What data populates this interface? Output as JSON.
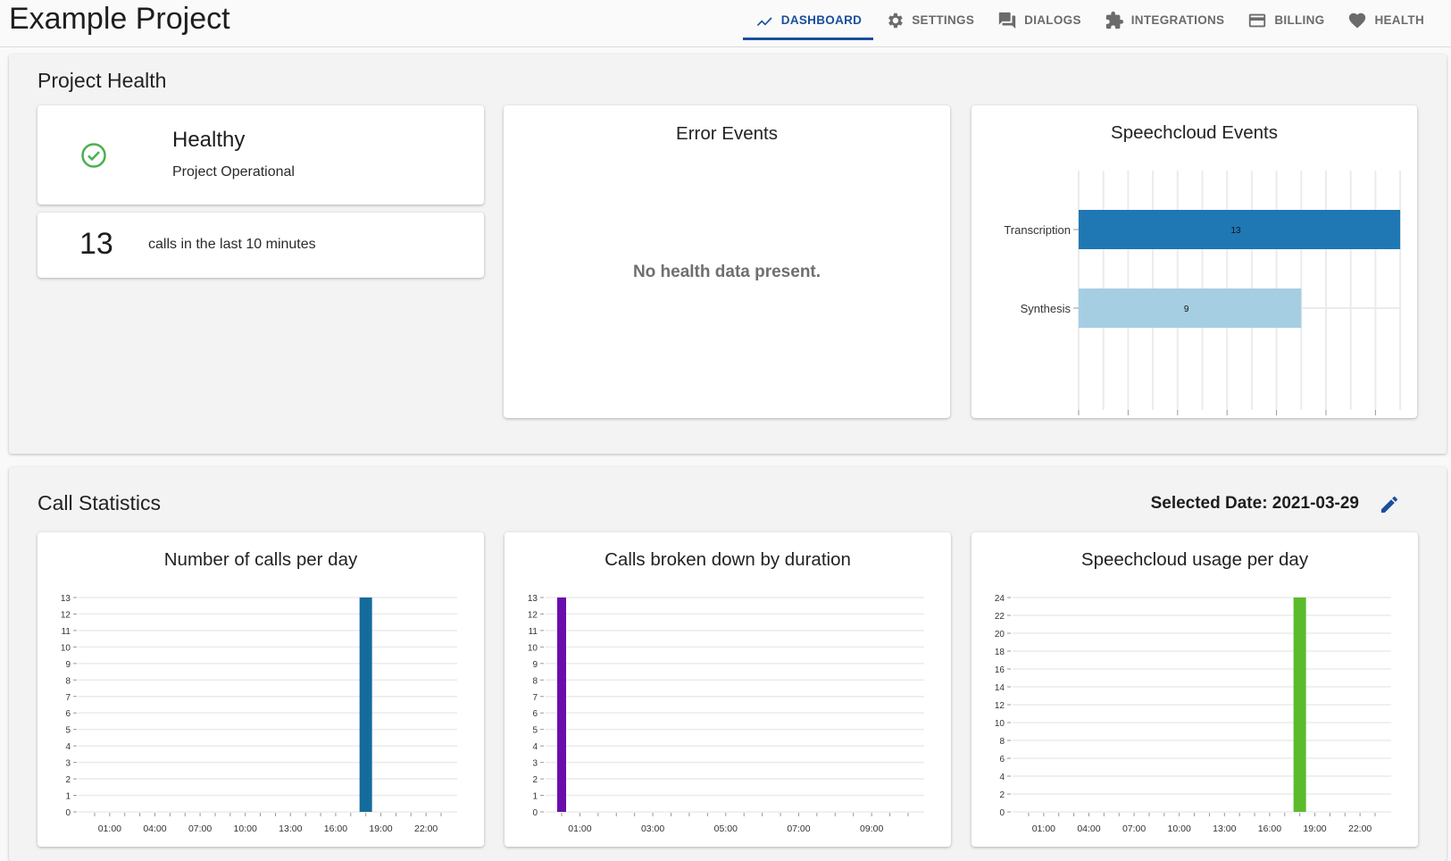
{
  "app": {
    "title": "Example Project"
  },
  "nav": {
    "tabs": [
      {
        "label": "DASHBOARD",
        "icon": "trending-line-icon",
        "active": true
      },
      {
        "label": "SETTINGS",
        "icon": "gear-icon",
        "active": false
      },
      {
        "label": "DIALOGS",
        "icon": "chat-bubbles-icon",
        "active": false
      },
      {
        "label": "INTEGRATIONS",
        "icon": "puzzle-piece-icon",
        "active": false
      },
      {
        "label": "BILLING",
        "icon": "credit-card-icon",
        "active": false
      },
      {
        "label": "HEALTH",
        "icon": "heart-icon",
        "active": false
      }
    ]
  },
  "health": {
    "section_title": "Project Health",
    "status": {
      "title": "Healthy",
      "subtitle": "Project Operational",
      "icon": "check-circle-icon",
      "color": "#4caf50"
    },
    "recent_calls": {
      "count": "13",
      "text": "calls in the last 10 minutes"
    },
    "error_events": {
      "title": "Error Events",
      "empty_text": "No health data present."
    },
    "speechcloud_events": {
      "title": "Speechcloud Events"
    }
  },
  "stats": {
    "section_title": "Call Statistics",
    "selected_date": "Selected Date: 2021-03-29",
    "edit_icon": "pencil-icon"
  },
  "colors": {
    "accent": "#1a4f9c",
    "transcription": "#1f77b4",
    "synthesis": "#a6cee3",
    "calls_per_day": "#156c9c",
    "duration": "#6a0dad",
    "usage": "#5bbb2b"
  },
  "chart_data": [
    {
      "id": "speechcloud-events",
      "type": "bar",
      "orientation": "horizontal",
      "title": "Speechcloud Events",
      "categories": [
        "Transcription",
        "Synthesis"
      ],
      "values": [
        13,
        9
      ],
      "data_labels": [
        "13",
        "9"
      ],
      "xlim": [
        0,
        13
      ],
      "xticks": [
        0,
        2,
        4,
        6,
        8,
        10,
        12
      ],
      "grid": true
    },
    {
      "id": "calls-per-day",
      "type": "bar",
      "title": "Number of calls per day",
      "x_hours": [
        18
      ],
      "values": [
        13
      ],
      "ylim": [
        0,
        13
      ],
      "yticks": [
        0,
        1,
        2,
        3,
        4,
        5,
        6,
        7,
        8,
        9,
        10,
        11,
        12,
        13
      ],
      "xtick_labels": [
        "01:00",
        "04:00",
        "07:00",
        "10:00",
        "13:00",
        "16:00",
        "19:00",
        "22:00"
      ],
      "x_range_hours": [
        0,
        23
      ],
      "grid": true
    },
    {
      "id": "calls-by-duration",
      "type": "bar",
      "title": "Calls broken down by duration",
      "x_hours": [
        0.5
      ],
      "values": [
        13
      ],
      "ylim": [
        0,
        13
      ],
      "yticks": [
        0,
        1,
        2,
        3,
        4,
        5,
        6,
        7,
        8,
        9,
        10,
        11,
        12,
        13
      ],
      "xtick_labels": [
        "01:00",
        "03:00",
        "05:00",
        "07:00",
        "09:00"
      ],
      "x_range_hours": [
        0.5,
        10
      ],
      "grid": true
    },
    {
      "id": "speechcloud-usage",
      "type": "bar",
      "title": "Speechcloud usage per day",
      "x_hours": [
        18
      ],
      "values": [
        24
      ],
      "ylim": [
        0,
        24
      ],
      "yticks": [
        0,
        2,
        4,
        6,
        8,
        10,
        12,
        14,
        16,
        18,
        20,
        22,
        24
      ],
      "xtick_labels": [
        "01:00",
        "04:00",
        "07:00",
        "10:00",
        "13:00",
        "16:00",
        "19:00",
        "22:00"
      ],
      "x_range_hours": [
        0,
        23
      ],
      "grid": true
    }
  ]
}
